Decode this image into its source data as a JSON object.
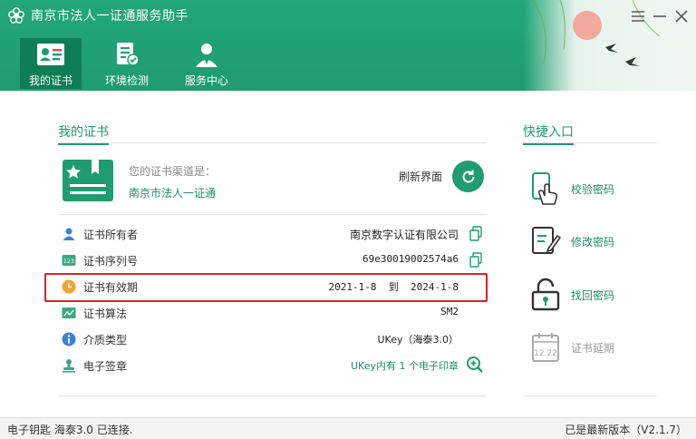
{
  "app": {
    "title": "南京市法人一证通服务助手"
  },
  "nav": [
    {
      "label": "我的证书",
      "icon": "id-card-icon",
      "active": true
    },
    {
      "label": "环境检测",
      "icon": "checklist-icon",
      "active": false
    },
    {
      "label": "服务中心",
      "icon": "service-person-icon",
      "active": false
    }
  ],
  "main": {
    "section_title": "我的证书",
    "channel_label": "您的证书渠道是：",
    "channel_value": "南京市法人一证通",
    "refresh_label": "刷新界面",
    "rows": [
      {
        "label": "证书所有者",
        "value": "南京数字认证有限公司",
        "icon": "person-icon"
      },
      {
        "label": "证书序列号",
        "value": "69e30019002574a6",
        "icon": "serial-number-icon"
      },
      {
        "label": "证书有效期",
        "value": "2021-1-8  到  2024-1-8",
        "icon": "clock-icon"
      },
      {
        "label": "证书算法",
        "value": "SM2",
        "icon": "algorithm-icon"
      },
      {
        "label": "介质类型",
        "value": "UKey（海泰3.0）",
        "icon": "info-icon"
      },
      {
        "label": "电子签章",
        "value": "UKey内有 1 个电子印章",
        "icon": "stamp-icon"
      }
    ]
  },
  "quick": {
    "title": "快捷入口",
    "items": [
      {
        "label": "校验密码",
        "icon": "tap-phone-icon",
        "enabled": true
      },
      {
        "label": "修改密码",
        "icon": "edit-note-icon",
        "enabled": true
      },
      {
        "label": "找回密码",
        "icon": "unlock-icon",
        "enabled": true
      },
      {
        "label": "证书延期",
        "icon": "calendar-icon",
        "enabled": false,
        "calendar_text": "12.22"
      }
    ]
  },
  "status": {
    "left": "电子钥匙 海泰3.0 已连接.",
    "right": "已是最新版本（V2.1.7）"
  },
  "colors": {
    "brand": "#1f9c70",
    "highlight": "#e02020",
    "link": "#1a8f66"
  }
}
